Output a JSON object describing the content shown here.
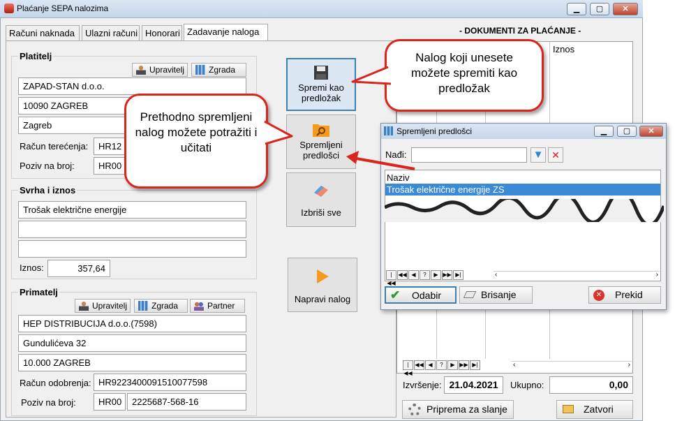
{
  "window": {
    "title": "Plaćanje SEPA nalozima",
    "min": "▁",
    "max": "▢",
    "close": "✕"
  },
  "tabs": [
    "Računi naknada",
    "Ulazni računi",
    "Honorari",
    "Zadavanje naloga"
  ],
  "platitelj": {
    "label": "Platitelj",
    "btn_upravitelj": "Upravitelj",
    "btn_zgrada": "Zgrada",
    "name": "ZAPAD-STAN d.o.o.",
    "postal": "10090 ZAGREB",
    "city": "Zagreb",
    "racun_label": "Račun terećenja:",
    "racun_value": "HR12",
    "poziv_label": "Poziv na broj:",
    "poziv_value": "HR00"
  },
  "svrha": {
    "label": "Svrha i iznos",
    "line1": "Trošak električne energije",
    "line2": "",
    "line3": "",
    "iznos_label": "Iznos:",
    "iznos_value": "357,64"
  },
  "primatelj": {
    "label": "Primatelj",
    "btn_upravitelj": "Upravitelj",
    "btn_zgrada": "Zgrada",
    "btn_partner": "Partner",
    "name": "HEP DISTRIBUCIJA d.o.o.(7598)",
    "street": "Gundulićeva 32",
    "postal": "10.000 ZAGREB",
    "racun_label": "Račun odobrenja:",
    "racun_value": "HR9223400091510077598",
    "poziv_label": "Poziv na broj:",
    "poziv_model": "HR00",
    "poziv_value": "2225687-568-16"
  },
  "actions": {
    "spremi_line1": "Spremi kao",
    "spremi_line2": "predložak",
    "predlosci_line1": "Spremljeni",
    "predlosci_line2": "predlošci",
    "izbrisi": "Izbriši sve",
    "napravi": "Napravi nalog"
  },
  "documents": {
    "header": "- DOKUMENTI ZA PLAĆANJE -",
    "col_iznos": "Iznos",
    "izvrsenje_label": "Izvršenje:",
    "izvrsenje_value": "21.04.2021",
    "ukupno_label": "Ukupno:",
    "ukupno_value": "0,00",
    "btn_priprema": "Priprema za slanje",
    "btn_zatvori": "Zatvori"
  },
  "dialog": {
    "title": "Spremljeni predlošci",
    "nadi_label": "Nađi:",
    "nadi_value": "",
    "col_naziv": "Naziv",
    "row1": "Trošak električne energije ZS",
    "btn_odabir": "Odabir",
    "btn_brisanje": "Brisanje",
    "btn_prekid": "Prekid"
  },
  "callouts": {
    "spremi": "Nalog koji unesete možete spremiti kao predložak",
    "predlosci": "Prethodno spremljeni nalog možete potražiti i učitati"
  },
  "colors": {
    "selection": "#3a8ad8",
    "callout_border": "#d9251c",
    "accent_orange": "#f29b1d"
  }
}
